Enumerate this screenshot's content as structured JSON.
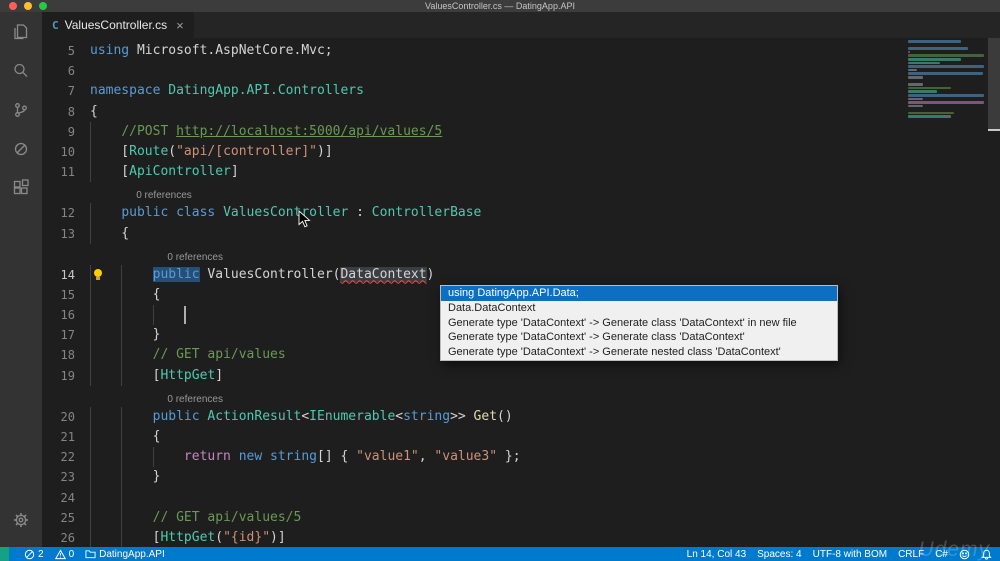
{
  "window": {
    "title": "ValuesController.cs — DatingApp.API"
  },
  "colors": {
    "accent": "#007acc",
    "selection": "#264f78",
    "error_squiggle": "#f14c4c",
    "popup_selection": "#0c6fc4"
  },
  "activity_bar": {
    "items": [
      "explorer",
      "search",
      "source-control",
      "debug",
      "extensions"
    ],
    "bottom": "settings-gear"
  },
  "tab": {
    "icon_glyph": "C",
    "label": "ValuesController.cs",
    "close_glyph": "×"
  },
  "editor": {
    "lines": [
      {
        "num": "5",
        "guides": 0,
        "tokens": [
          {
            "t": "using",
            "c": "k"
          },
          {
            "t": " Microsoft.AspNetCore.Mvc;",
            "c": "p"
          }
        ]
      },
      {
        "num": "6",
        "guides": 0,
        "tokens": []
      },
      {
        "num": "7",
        "guides": 0,
        "tokens": [
          {
            "t": "namespace",
            "c": "k"
          },
          {
            "t": " ",
            "c": "p"
          },
          {
            "t": "DatingApp.API.Controllers",
            "c": "t"
          }
        ]
      },
      {
        "num": "8",
        "guides": 0,
        "tokens": [
          {
            "t": "{",
            "c": "p"
          }
        ]
      },
      {
        "num": "9",
        "guides": 1,
        "tokens": [
          {
            "t": "    ",
            "c": "p"
          },
          {
            "t": "//POST ",
            "c": "c"
          },
          {
            "t": "http://localhost:5000/api/values/5",
            "c": "cl"
          }
        ]
      },
      {
        "num": "10",
        "guides": 1,
        "tokens": [
          {
            "t": "    [",
            "c": "p"
          },
          {
            "t": "Route",
            "c": "t"
          },
          {
            "t": "(",
            "c": "p"
          },
          {
            "t": "\"api/[controller]\"",
            "c": "s"
          },
          {
            "t": ")]",
            "c": "p"
          }
        ]
      },
      {
        "num": "11",
        "guides": 1,
        "tokens": [
          {
            "t": "    [",
            "c": "p"
          },
          {
            "t": "ApiController",
            "c": "t"
          },
          {
            "t": "]",
            "c": "p"
          }
        ]
      },
      {
        "lens": true,
        "text": "0 references",
        "indent": 4
      },
      {
        "num": "12",
        "guides": 1,
        "tokens": [
          {
            "t": "    ",
            "c": "p"
          },
          {
            "t": "public",
            "c": "k"
          },
          {
            "t": " ",
            "c": "p"
          },
          {
            "t": "class",
            "c": "k"
          },
          {
            "t": " ",
            "c": "p"
          },
          {
            "t": "ValuesController",
            "c": "t"
          },
          {
            "t": " : ",
            "c": "p"
          },
          {
            "t": "ControllerBase",
            "c": "t"
          }
        ]
      },
      {
        "num": "13",
        "guides": 1,
        "tokens": [
          {
            "t": "    {",
            "c": "p"
          }
        ]
      },
      {
        "lens": true,
        "text": "0 references",
        "indent": 8
      },
      {
        "num": "14",
        "guides": 2,
        "active": true,
        "bulb": true,
        "tokens": [
          {
            "t": "        ",
            "c": "p"
          },
          {
            "t": "public",
            "c": "k sel"
          },
          {
            "t": " ",
            "c": "p"
          },
          {
            "t": "ValuesController",
            "c": "p"
          },
          {
            "t": "(",
            "c": "p"
          },
          {
            "t": "DataContext",
            "c": "err"
          },
          {
            "t": ")",
            "c": "p"
          }
        ]
      },
      {
        "num": "15",
        "guides": 2,
        "tokens": [
          {
            "t": "        {",
            "c": "p"
          }
        ]
      },
      {
        "num": "16",
        "guides": 3,
        "caret": 12,
        "tokens": []
      },
      {
        "num": "17",
        "guides": 2,
        "tokens": [
          {
            "t": "        }",
            "c": "p"
          }
        ]
      },
      {
        "num": "18",
        "guides": 2,
        "tokens": [
          {
            "t": "        ",
            "c": "p"
          },
          {
            "t": "// GET api/values",
            "c": "c"
          }
        ]
      },
      {
        "num": "19",
        "guides": 2,
        "tokens": [
          {
            "t": "        [",
            "c": "p"
          },
          {
            "t": "HttpGet",
            "c": "t"
          },
          {
            "t": "]",
            "c": "p"
          }
        ]
      },
      {
        "lens": true,
        "text": "0 references",
        "indent": 8
      },
      {
        "num": "20",
        "guides": 2,
        "tokens": [
          {
            "t": "        ",
            "c": "p"
          },
          {
            "t": "public",
            "c": "k"
          },
          {
            "t": " ",
            "c": "p"
          },
          {
            "t": "ActionResult",
            "c": "t"
          },
          {
            "t": "<",
            "c": "p"
          },
          {
            "t": "IEnumerable",
            "c": "t"
          },
          {
            "t": "<",
            "c": "p"
          },
          {
            "t": "string",
            "c": "k"
          },
          {
            "t": ">> ",
            "c": "p"
          },
          {
            "t": "Get",
            "c": "fn"
          },
          {
            "t": "()",
            "c": "p"
          }
        ]
      },
      {
        "num": "21",
        "guides": 2,
        "tokens": [
          {
            "t": "        {",
            "c": "p"
          }
        ]
      },
      {
        "num": "22",
        "guides": 3,
        "tokens": [
          {
            "t": "            ",
            "c": "p"
          },
          {
            "t": "return",
            "c": "ctrl"
          },
          {
            "t": " ",
            "c": "p"
          },
          {
            "t": "new",
            "c": "k"
          },
          {
            "t": " ",
            "c": "p"
          },
          {
            "t": "string",
            "c": "k"
          },
          {
            "t": "[] { ",
            "c": "p"
          },
          {
            "t": "\"value1\"",
            "c": "s"
          },
          {
            "t": ", ",
            "c": "p"
          },
          {
            "t": "\"value3\"",
            "c": "s"
          },
          {
            "t": " };",
            "c": "p"
          }
        ]
      },
      {
        "num": "23",
        "guides": 2,
        "tokens": [
          {
            "t": "        }",
            "c": "p"
          }
        ]
      },
      {
        "num": "24",
        "guides": 2,
        "tokens": []
      },
      {
        "num": "25",
        "guides": 2,
        "tokens": [
          {
            "t": "        ",
            "c": "p"
          },
          {
            "t": "// GET api/values/5",
            "c": "c"
          }
        ]
      },
      {
        "num": "26",
        "guides": 2,
        "tokens": [
          {
            "t": "        [",
            "c": "p"
          },
          {
            "t": "HttpGet",
            "c": "t"
          },
          {
            "t": "(",
            "c": "p"
          },
          {
            "t": "\"{id}\"",
            "c": "s"
          },
          {
            "t": ")]",
            "c": "p"
          }
        ]
      }
    ]
  },
  "popup": {
    "items": [
      {
        "label": "using DatingApp.API.Data;",
        "selected": true
      },
      {
        "label": "Data.DataContext",
        "selected": false
      },
      {
        "label": "Generate type 'DataContext' -> Generate class 'DataContext' in new file",
        "selected": false
      },
      {
        "label": "Generate type 'DataContext' -> Generate class 'DataContext'",
        "selected": false
      },
      {
        "label": "Generate type 'DataContext' -> Generate nested class 'DataContext'",
        "selected": false
      }
    ]
  },
  "status_bar": {
    "errors": "2",
    "warnings": "0",
    "project": "DatingApp.API",
    "line_col": "Ln 14, Col 43",
    "spaces": "Spaces: 4",
    "encoding": "UTF-8 with BOM",
    "eol": "CRLF",
    "language": "C#"
  },
  "watermark": "Udemy"
}
